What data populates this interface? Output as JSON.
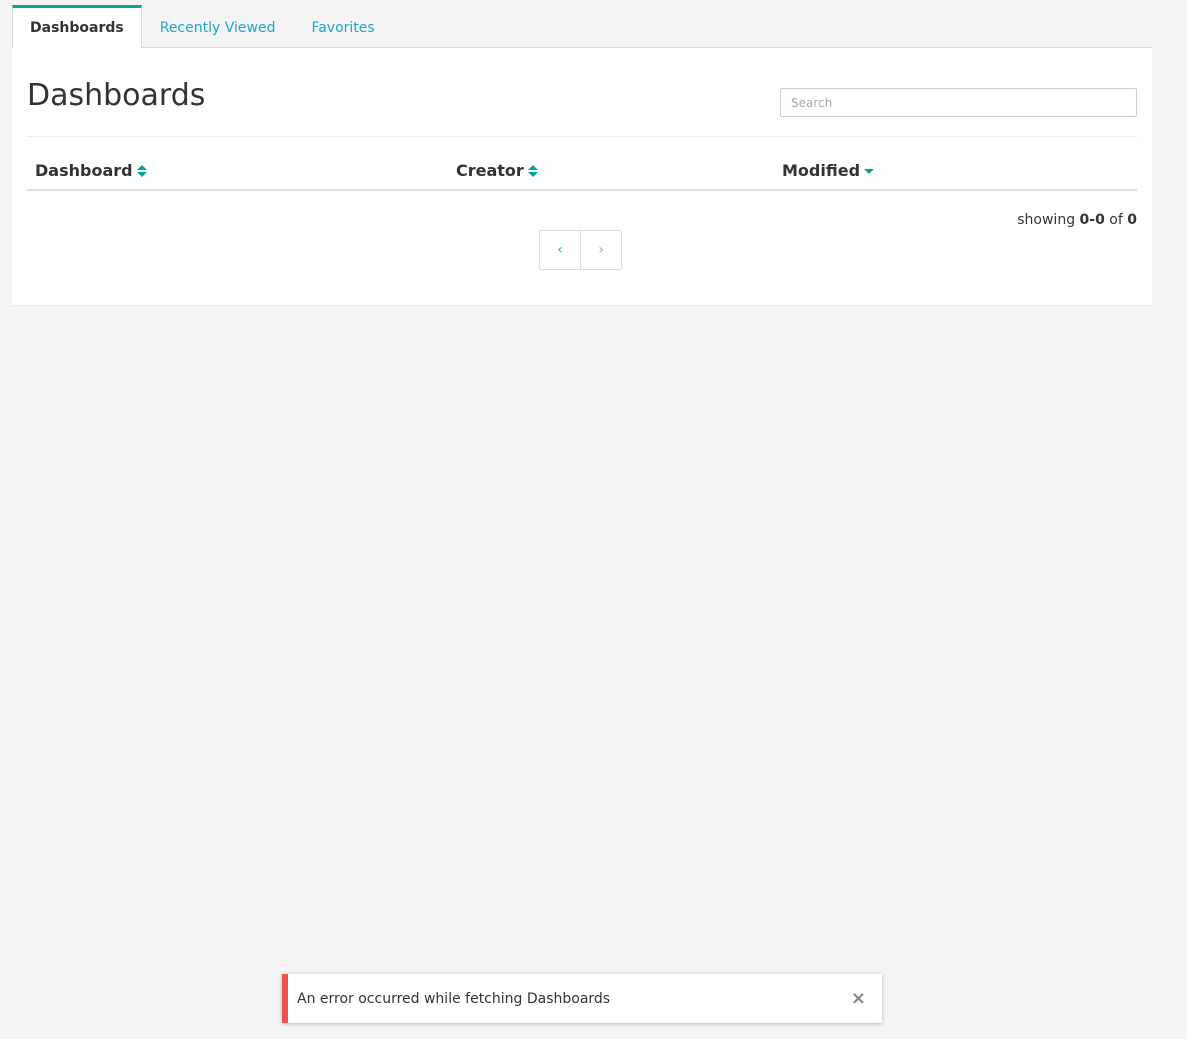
{
  "tabs": [
    {
      "label": "Dashboards",
      "active": true
    },
    {
      "label": "Recently Viewed",
      "active": false
    },
    {
      "label": "Favorites",
      "active": false
    }
  ],
  "page": {
    "title": "Dashboards",
    "search_placeholder": "Search"
  },
  "table": {
    "columns": [
      {
        "label": "Dashboard",
        "sort": "both"
      },
      {
        "label": "Creator",
        "sort": "both"
      },
      {
        "label": "Modified",
        "sort": "desc"
      }
    ]
  },
  "pagination": {
    "showing_label": "showing",
    "range": "0-0",
    "of_label": "of",
    "total": "0",
    "prev_glyph": "‹",
    "next_glyph": "›"
  },
  "toast": {
    "message": "An error occurred while fetching Dashboards",
    "close_glyph": "×",
    "accent_color": "#ef5350"
  },
  "colors": {
    "accent": "#00a699",
    "link": "#20a7c9",
    "background": "#f4f4f4"
  }
}
